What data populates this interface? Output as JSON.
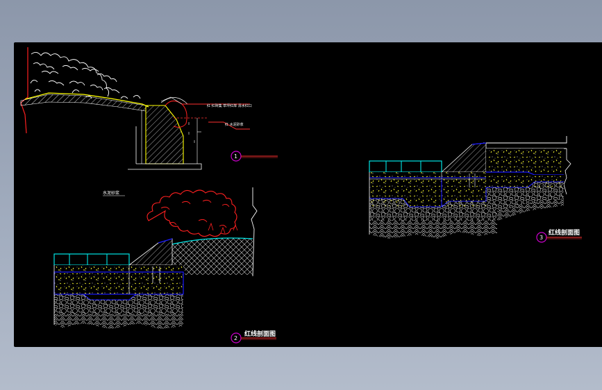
{
  "drawing": {
    "section_1": {
      "marker": "1",
      "note_top": "红 红砖集 草坪红岸 清水红口",
      "note_mid": "红 水泥砂浆"
    },
    "section_2": {
      "marker": "2",
      "title": "红线剖面图",
      "label_above": "水泥砂浆"
    },
    "section_3": {
      "marker": "3",
      "title": "红线剖面图"
    }
  },
  "colors": {
    "background": "#000000",
    "paving_tiles": "#00e5e5",
    "foundation_outline": "#1a1aff",
    "aggregate_dots": "#ffff33",
    "hatch_lines": "#e8e8e8",
    "planting_red": "#ff2020",
    "wall_yellow": "#ffff00",
    "leader_red": "#ff3030",
    "marker_circle": "#cc00cc"
  }
}
